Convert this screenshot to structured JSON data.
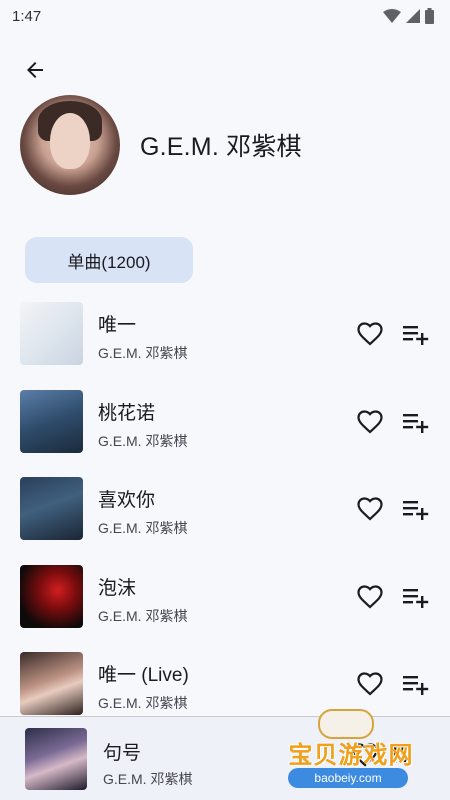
{
  "status_bar": {
    "time": "1:47"
  },
  "artist": {
    "name": "G.E.M. 邓紫棋"
  },
  "tab": {
    "label": "单曲(1200)"
  },
  "songs": [
    {
      "title": "唯一",
      "artist": "G.E.M. 邓紫棋"
    },
    {
      "title": "桃花诺",
      "artist": "G.E.M. 邓紫棋"
    },
    {
      "title": "喜欢你",
      "artist": "G.E.M. 邓紫棋"
    },
    {
      "title": "泡沫",
      "artist": "G.E.M. 邓紫棋"
    },
    {
      "title": "唯一 (Live)",
      "artist": "G.E.M. 邓紫棋"
    }
  ],
  "now_playing": {
    "title": "句号",
    "artist": "G.E.M. 邓紫棋"
  },
  "watermark": {
    "text": "宝贝游戏网",
    "url": "baobeiy.com"
  },
  "icons": {
    "back": "arrow-left-icon",
    "favorite": "heart-outline-icon",
    "add_to_queue": "playlist-add-icon",
    "pause": "pause-icon",
    "wifi": "wifi-icon",
    "signal": "cellular-signal-icon",
    "battery": "battery-icon"
  },
  "colors": {
    "background": "#f6f8fc",
    "tab_chip": "#d9e3f6",
    "player_bar": "#eef1f8",
    "primary_text": "#1b1b1f",
    "secondary_text": "#45464f"
  }
}
